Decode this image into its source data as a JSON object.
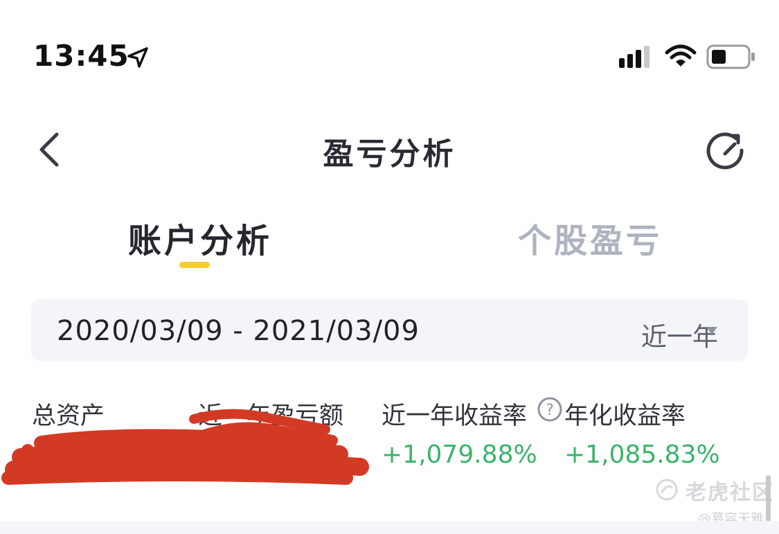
{
  "status_bar": {
    "time": "13:45",
    "icons": [
      "location-arrow-icon",
      "cellular-signal-icon",
      "wifi-icon",
      "battery-icon"
    ]
  },
  "header": {
    "title": "盈亏分析",
    "back_icon": "chevron-left-icon",
    "refresh_icon": "refresh-icon"
  },
  "tabs": [
    {
      "label": "账户分析",
      "active": true
    },
    {
      "label": "个股盈亏",
      "active": false
    }
  ],
  "date_filter": {
    "range": "2020/03/09 - 2021/03/09",
    "period": "近一年",
    "caret_icon": "caret-down-icon"
  },
  "metrics": [
    {
      "label": "总资产",
      "value": ""
    },
    {
      "label": "近一年盈亏额",
      "value": ""
    },
    {
      "label": "近一年收益率",
      "value": "+1,079.88%"
    },
    {
      "label": "年化收益率",
      "value": "+1,085.83%"
    }
  ],
  "watermark": {
    "brand": "老虎社区",
    "user": "@慕容天雅"
  },
  "colors": {
    "accent": "#f5cd2f",
    "positive": "#3bb36a",
    "inactive_tab": "#aeb3bf",
    "redaction": "#d33a24"
  }
}
